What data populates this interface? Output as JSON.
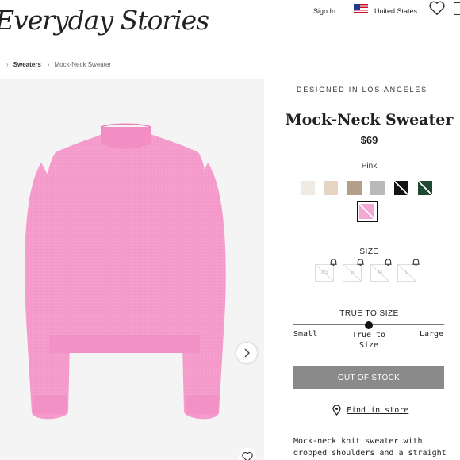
{
  "header": {
    "logo": "Everyday Stories",
    "sign_in": "Sign In",
    "country": "United States"
  },
  "breadcrumb": {
    "items": [
      "Sweaters",
      "Mock-Neck Sweater"
    ]
  },
  "product": {
    "designed_in": "DESIGNED IN LOS ANGELES",
    "title": "Mock-Neck Sweater",
    "price": "$69",
    "color_name": "Pink",
    "colors": [
      {
        "hex": "#efebe3",
        "available": true
      },
      {
        "hex": "#e3d4c4",
        "available": true
      },
      {
        "hex": "#b39e8a",
        "available": true
      },
      {
        "hex": "#b9b9b9",
        "available": true
      },
      {
        "hex": "#141414",
        "available": false
      },
      {
        "hex": "#1e4a32",
        "available": false
      },
      {
        "hex": "#f3a7d3",
        "available": false,
        "selected": true
      }
    ],
    "size_label": "SIZE",
    "sizes": [
      "XS",
      "S",
      "M",
      "L"
    ],
    "fit": {
      "title": "TRUE TO SIZE",
      "small": "Small",
      "true": "True to Size",
      "large": "Large",
      "value": 0.5
    },
    "cta": "OUT OF STOCK",
    "find_in_store": "Find in store",
    "description": "Mock-neck knit sweater with dropped shoulders and a straight silhouette."
  },
  "colors": {
    "sweater": "#f59bcb",
    "image_bg": "#f4f4f4",
    "button_disabled": "#8a8a8a"
  },
  "icons": [
    "us-flag-icon",
    "heart-icon",
    "bag-icon",
    "chevron-right-icon",
    "bell-icon",
    "location-pin-icon"
  ]
}
